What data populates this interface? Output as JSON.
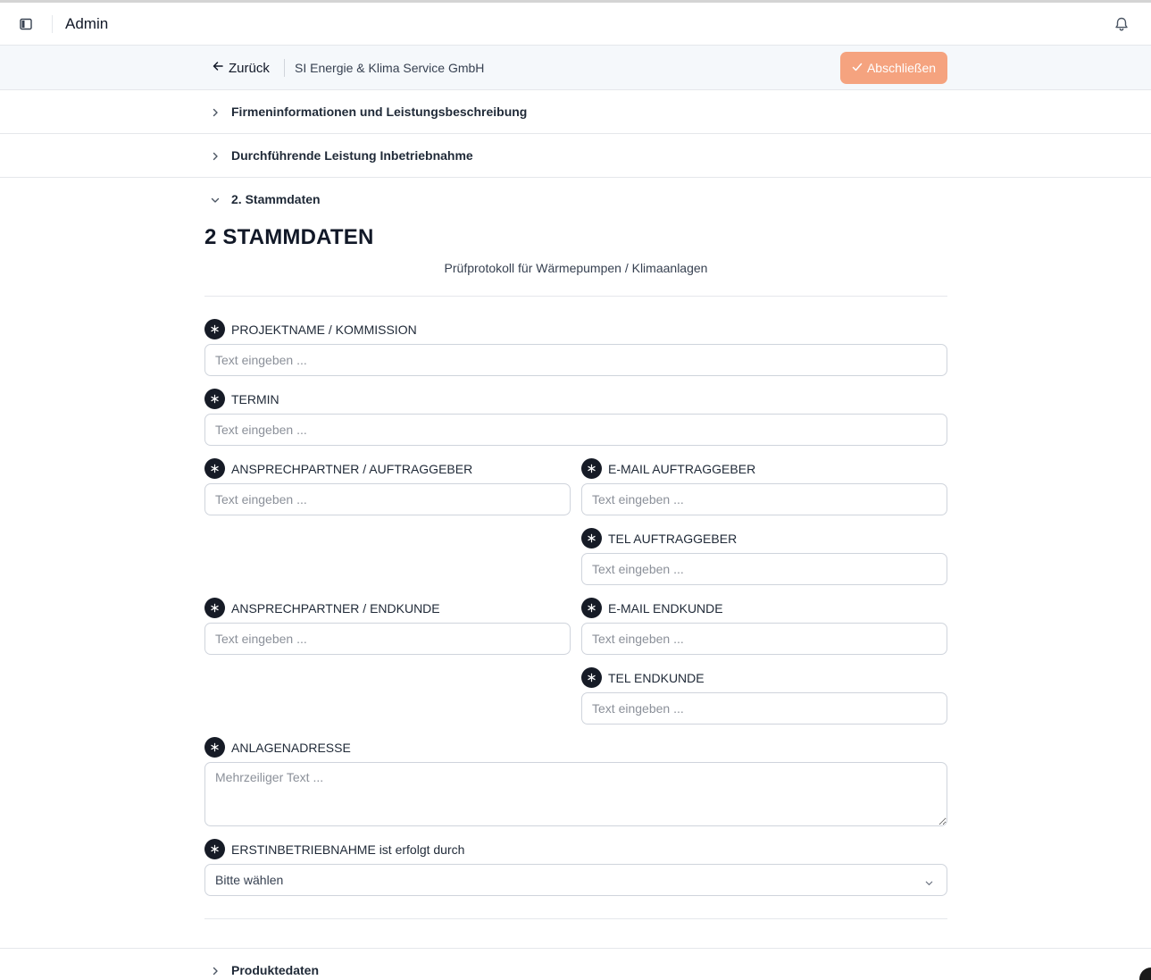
{
  "header": {
    "title": "Admin",
    "sidebar_toggle_icon": "sidebar-toggle-icon",
    "bell_icon": "bell-icon"
  },
  "toolbar": {
    "back_label": "Zurück",
    "company": "SI Energie & Klima Service GmbH",
    "finish_label": "Abschließen",
    "finish_color": "#f5a37f"
  },
  "accordion": [
    {
      "label": "Firmeninformationen und Leistungsbeschreibung",
      "expanded": false
    },
    {
      "label": "Durchführende Leistung Inbetriebnahme",
      "expanded": false
    },
    {
      "label": "2. Stammdaten",
      "expanded": true
    },
    {
      "label": "Produktedaten",
      "expanded": false
    }
  ],
  "section": {
    "title": "2 STAMMDATEN",
    "subtitle": "Prüfprotokoll für Wärmepumpen / Klimaanlagen"
  },
  "fields": {
    "projektname": {
      "label": "PROJEKTNAME / KOMMISSION",
      "placeholder": "Text eingeben ...",
      "value": ""
    },
    "termin": {
      "label": "TERMIN",
      "placeholder": "Text eingeben ...",
      "value": ""
    },
    "ansprechpartner_auftraggeber": {
      "label": "ANSPRECHPARTNER / AUFTRAGGEBER",
      "placeholder": "Text eingeben ...",
      "value": ""
    },
    "email_auftraggeber": {
      "label": "E-MAIL AUFTRAGGEBER",
      "placeholder": "Text eingeben ...",
      "value": ""
    },
    "tel_auftraggeber": {
      "label": "TEL AUFTRAGGEBER",
      "placeholder": "Text eingeben ...",
      "value": ""
    },
    "ansprechpartner_endkunde": {
      "label": "ANSPRECHPARTNER / ENDKUNDE",
      "placeholder": "Text eingeben ...",
      "value": ""
    },
    "email_endkunde": {
      "label": "E-MAIL ENDKUNDE",
      "placeholder": "Text eingeben ...",
      "value": ""
    },
    "tel_endkunde": {
      "label": "TEL ENDKUNDE",
      "placeholder": "Text eingeben ...",
      "value": ""
    },
    "anlagenadresse": {
      "label": "ANLAGENADRESSE",
      "placeholder": "Mehrzeiliger Text ...",
      "value": ""
    },
    "erstinbetriebnahme": {
      "label": "ERSTINBETRIEBNAHME ist erfolgt durch",
      "selected": "Bitte wählen"
    }
  },
  "required_icon": "asterisk-icon"
}
